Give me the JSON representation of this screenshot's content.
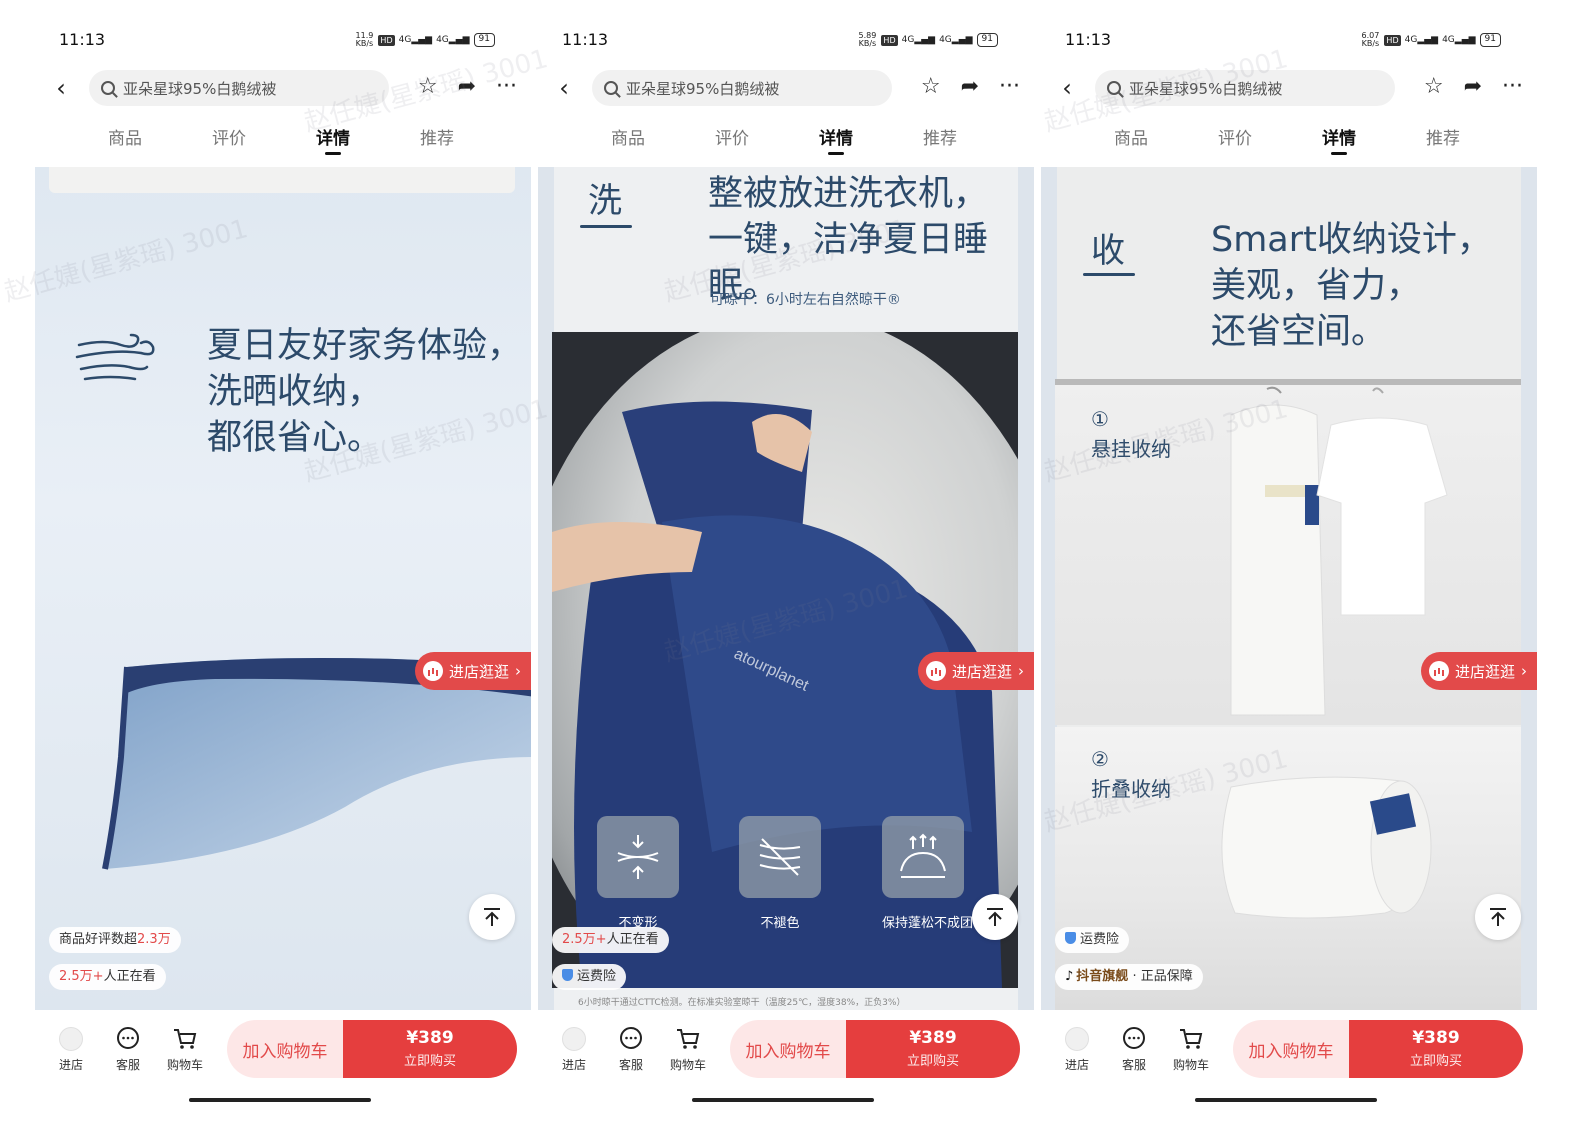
{
  "screens": [
    {
      "status": {
        "time": "11:13",
        "speed": "11.9\nKB/s",
        "hd": "HD",
        "net1": "4G",
        "net2": "4G",
        "battery": "91"
      },
      "search": {
        "placeholder": "亚朵星球95%白鹅绒被"
      },
      "tabs": [
        "商品",
        "评价",
        "详情",
        "推荐"
      ],
      "active_tab": "详情",
      "headline": [
        "夏日友好家务体验，",
        "洗晒收纳，",
        "都很省心。"
      ],
      "chips": [
        {
          "prefix": "商品好评数超",
          "highlight": "2.3万",
          "suffix": ""
        },
        {
          "prefix": "",
          "highlight": "2.5万+",
          "suffix": "人正在看"
        }
      ],
      "shop_button": "进店逛逛",
      "bottom": {
        "store": "进店",
        "service": "客服",
        "cart": "购物车",
        "add_to_cart": "加入购物车",
        "price": "¥389",
        "buy_now": "立即购买"
      }
    },
    {
      "status": {
        "time": "11:13",
        "speed": "5.89\nKB/s",
        "hd": "HD",
        "net1": "4G",
        "net2": "4G",
        "battery": "91"
      },
      "search": {
        "placeholder": "亚朵星球95%白鹅绒被"
      },
      "tabs": [
        "商品",
        "评价",
        "详情",
        "推荐"
      ],
      "active_tab": "详情",
      "big_label": "洗",
      "headline": [
        "整被放进洗衣机，",
        "一键，洁净夏日睡眠。"
      ],
      "caption": "可晾干：6小时左右自然晾干®",
      "product_brand_print": "atourplanet",
      "features": [
        "不变形",
        "不褪色",
        "保持蓬松不成团"
      ],
      "chips": [
        {
          "prefix": "",
          "highlight": "2.5万+",
          "suffix": "人正在看"
        },
        {
          "prefix": "",
          "highlight": "",
          "suffix": "运费险"
        }
      ],
      "footnote": "6小时晾干通过CTTC检测。在标准实验室晾干（温度25℃，湿度38%，正负3%）",
      "shop_button": "进店逛逛",
      "bottom": {
        "store": "进店",
        "service": "客服",
        "cart": "购物车",
        "add_to_cart": "加入购物车",
        "price": "¥389",
        "buy_now": "立即购买"
      }
    },
    {
      "status": {
        "time": "11:13",
        "speed": "6.07\nKB/s",
        "hd": "HD",
        "net1": "4G",
        "net2": "4G",
        "battery": "91"
      },
      "search": {
        "placeholder": "亚朵星球95%白鹅绒被"
      },
      "tabs": [
        "商品",
        "评价",
        "详情",
        "推荐"
      ],
      "active_tab": "详情",
      "big_label": "收",
      "headline": [
        "Smart收纳设计，",
        "美观，省力，",
        "还省空间。"
      ],
      "steps": [
        {
          "num": "①",
          "label": "悬挂收纳"
        },
        {
          "num": "②",
          "label": "折叠收纳"
        }
      ],
      "chips": [
        {
          "prefix": "",
          "highlight": "",
          "suffix": "运费险"
        },
        {
          "prefix": "抖音旗舰",
          "highlight": "",
          "suffix": " · 正品保障"
        }
      ],
      "shop_button": "进店逛逛",
      "bottom": {
        "store": "进店",
        "service": "客服",
        "cart": "购物车",
        "add_to_cart": "加入购物车",
        "price": "¥389",
        "buy_now": "立即购买"
      }
    }
  ],
  "watermark": "赵任婕(星紫瑶) 3001",
  "colors": {
    "accent": "#e53e3e",
    "heading": "#2c4a6a",
    "cart_bg": "#fde7e7"
  }
}
